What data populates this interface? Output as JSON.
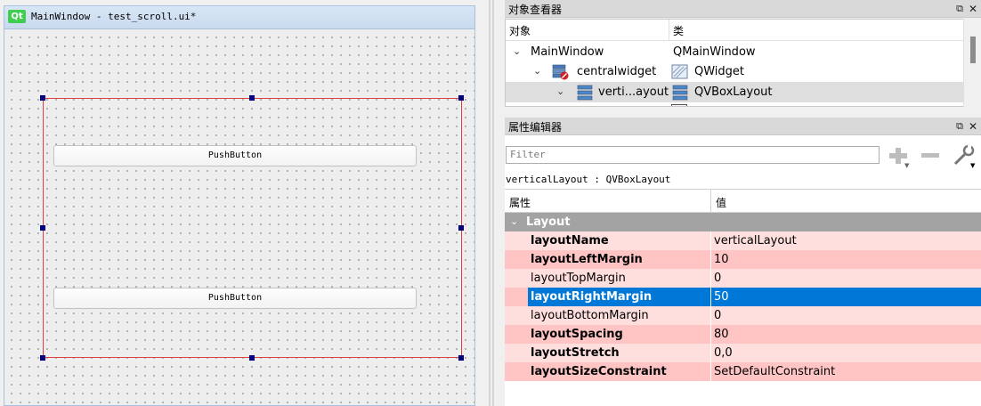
{
  "form": {
    "title": "MainWindow - test_scroll.ui*",
    "logo": "Qt",
    "buttons": [
      "PushButton",
      "PushButton"
    ]
  },
  "object_inspector": {
    "title": "对象查看器",
    "headers": [
      "对象",
      "类"
    ],
    "rows": [
      {
        "object": "MainWindow",
        "class": "QMainWindow",
        "icon": "none",
        "class_icon": "none"
      },
      {
        "object": "centralwidget",
        "class": "QWidget",
        "icon": "widget-broken-icon",
        "class_icon": "widget-class-icon"
      },
      {
        "object": "verti...ayout",
        "class": "QVBoxLayout",
        "icon": "vbox-layout-icon",
        "class_icon": "vbox-layout-icon"
      }
    ]
  },
  "property_editor": {
    "title": "属性编辑器",
    "filter_placeholder": "Filter",
    "object_path": "verticalLayout : QVBoxLayout",
    "headers": [
      "属性",
      "值"
    ],
    "group": "Layout",
    "properties": [
      {
        "name": "layoutName",
        "value": "verticalLayout",
        "bold": true,
        "selected": false
      },
      {
        "name": "layoutLeftMargin",
        "value": "10",
        "bold": true,
        "selected": false
      },
      {
        "name": "layoutTopMargin",
        "value": "0",
        "bold": false,
        "selected": false
      },
      {
        "name": "layoutRightMargin",
        "value": "50",
        "bold": true,
        "selected": true
      },
      {
        "name": "layoutBottomMargin",
        "value": "0",
        "bold": false,
        "selected": false
      },
      {
        "name": "layoutSpacing",
        "value": "80",
        "bold": true,
        "selected": false
      },
      {
        "name": "layoutStretch",
        "value": "0,0",
        "bold": true,
        "selected": false
      },
      {
        "name": "layoutSizeConstraint",
        "value": "SetDefaultConstraint",
        "bold": true,
        "selected": false
      }
    ]
  },
  "colors": {
    "selection": "#0078d7",
    "row_light": "#ffdede",
    "row_dark": "#ffc4c4",
    "group_header": "#a3a3a3",
    "layout_border": "#e04040"
  }
}
